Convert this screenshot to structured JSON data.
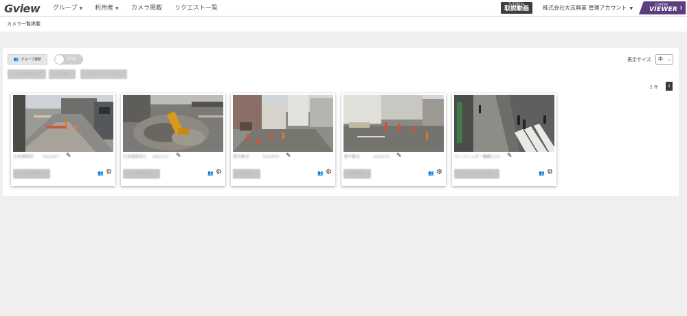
{
  "header": {
    "logo": "Gview",
    "nav": [
      {
        "label": "グループ",
        "dropdown": true
      },
      {
        "label": "利用者",
        "dropdown": true
      },
      {
        "label": "カメラ掲載",
        "dropdown": false
      },
      {
        "label": "リクエスト一覧",
        "dropdown": false
      }
    ],
    "tutorial_small": "TUTORIAL",
    "tutorial_label": "取説動画",
    "account": "株式会社大志興業 管理アカウント",
    "viewer_small": "G-PHONE",
    "viewer_label": "VIEWER"
  },
  "breadcrumb": "カメラ一覧掲載",
  "toolbar": {
    "group_select_label": "グループ選択",
    "toggle_label": "非所属",
    "group_chips": [
      "日本橋新所属",
      "港不動台",
      "ユニバリッター新所"
    ],
    "display_size_label": "表示サイズ",
    "display_size_value": "中",
    "result_count": "5 件",
    "current_page": "1"
  },
  "cameras": [
    {
      "name": "日本橋新所",
      "id": "HA2407",
      "tag": "日本橋新所属"
    },
    {
      "name": "日本橋新所2",
      "id": "HA2151",
      "tag": "日本橋新所属"
    },
    {
      "name": "港不動台",
      "id": "HA2859",
      "tag": "港不動台"
    },
    {
      "name": "港不動台",
      "id": "HA2076",
      "tag": "港不動台"
    },
    {
      "name": "ユニバリッター新所",
      "id": "HA2129",
      "tag": "ユニバリッター新所"
    }
  ],
  "icons": {
    "group_select": "people-icon",
    "edit": "pencil-icon",
    "card_group": "people-icon",
    "card_settings": "gear-icon"
  },
  "colors": {
    "viewer_bg": "#5c3d7e",
    "tutorial_bg": "#3e3e3e",
    "page_active": "#3a3a3a",
    "chip_bg": "#c9c9c9"
  }
}
